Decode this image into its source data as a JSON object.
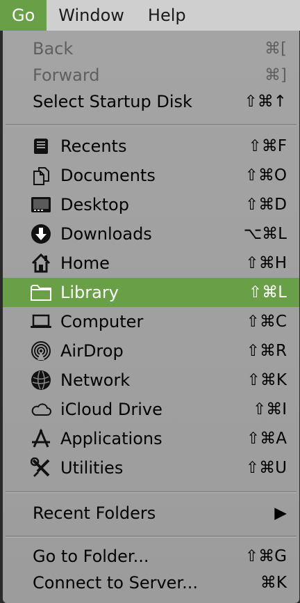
{
  "menubar": {
    "items": [
      {
        "label": "Go",
        "active": true
      },
      {
        "label": "Window",
        "active": false
      },
      {
        "label": "Help",
        "active": false
      }
    ]
  },
  "menu": {
    "back": {
      "label": "Back",
      "shortcut": "⌘["
    },
    "forward": {
      "label": "Forward",
      "shortcut": "⌘]"
    },
    "startup_disk": {
      "label": "Select Startup Disk",
      "shortcut": "⇧⌘↑"
    },
    "places": [
      {
        "label": "Recents",
        "shortcut": "⇧⌘F",
        "icon": "recents-icon"
      },
      {
        "label": "Documents",
        "shortcut": "⇧⌘O",
        "icon": "documents-icon"
      },
      {
        "label": "Desktop",
        "shortcut": "⇧⌘D",
        "icon": "desktop-icon"
      },
      {
        "label": "Downloads",
        "shortcut": "⌥⌘L",
        "icon": "downloads-icon"
      },
      {
        "label": "Home",
        "shortcut": "⇧⌘H",
        "icon": "home-icon"
      },
      {
        "label": "Library",
        "shortcut": "⇧⌘L",
        "icon": "folder-icon"
      },
      {
        "label": "Computer",
        "shortcut": "⇧⌘C",
        "icon": "computer-icon"
      },
      {
        "label": "AirDrop",
        "shortcut": "⇧⌘R",
        "icon": "airdrop-icon"
      },
      {
        "label": "Network",
        "shortcut": "⇧⌘K",
        "icon": "network-icon"
      },
      {
        "label": "iCloud Drive",
        "shortcut": "⇧⌘I",
        "icon": "cloud-icon"
      },
      {
        "label": "Applications",
        "shortcut": "⇧⌘A",
        "icon": "applications-icon"
      },
      {
        "label": "Utilities",
        "shortcut": "⇧⌘U",
        "icon": "utilities-icon"
      }
    ],
    "recent_folders": {
      "label": "Recent Folders",
      "submenu_indicator": "▶"
    },
    "go_to_folder": {
      "label": "Go to Folder...",
      "shortcut": "⇧⌘G"
    },
    "connect_server": {
      "label": "Connect to Server...",
      "shortcut": "⌘K"
    }
  },
  "colors": {
    "highlight": "#69a047",
    "menu_bg": "#a0a0a0",
    "menubar_bg": "#cfcfcf"
  }
}
